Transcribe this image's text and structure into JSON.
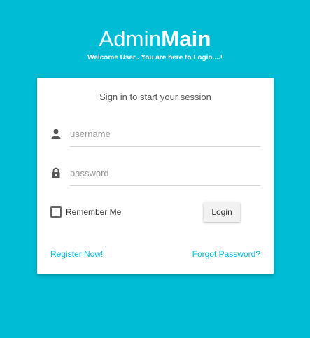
{
  "brand": {
    "title_light": "Admin",
    "title_bold": "Main",
    "subtitle": "Welcome User.. You are here to Login....!"
  },
  "login_box": {
    "heading": "Sign in to start your session",
    "username_placeholder": "username",
    "password_placeholder": "password",
    "remember_label": "Remember Me",
    "login_label": "Login",
    "register_link": "Register Now!",
    "forgot_link": "Forgot Password?"
  },
  "colors": {
    "background": "#00BCD4",
    "accent": "#00BCD4",
    "card": "#FFFFFF"
  },
  "icons": {
    "username": "person-icon",
    "password": "lock-icon"
  }
}
